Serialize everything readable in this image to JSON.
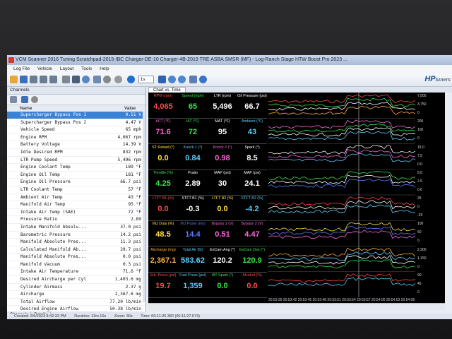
{
  "window": {
    "title": "VCM Scanner 2016 Tuning Scratchpad-2015-IBC Charger-DE-10 Charger-4B-2019 TRE ASBA SMSR (MF) - Log-Ranch Stage HTW Boost Pro 2023 ..."
  },
  "menu": [
    "Log File",
    "Vehicle",
    "Layout",
    "Tools",
    "Help"
  ],
  "toolbar": {
    "zoom_value": "1s"
  },
  "brand": {
    "logo": "HP",
    "logo_suffix": "tuners"
  },
  "channels": {
    "title": "Channels",
    "col_name": "Name",
    "col_value": "Value",
    "rows": [
      {
        "name": "Supercharger Bypass Pos 1",
        "value": "0.51 V",
        "selected": true
      },
      {
        "name": "Supercharger Bypass Pos 2",
        "value": "4.47 V"
      },
      {
        "name": "Vehicle Speed",
        "value": "65 mph"
      },
      {
        "name": "Engine RPM",
        "value": "4,067 rpm"
      },
      {
        "name": "Battery Voltage",
        "value": "14.39 V"
      },
      {
        "name": "Idle Desired RPM",
        "value": "832 rpm"
      },
      {
        "name": "LTR Pump Speed",
        "value": "5,496 rpm"
      },
      {
        "name": "Engine Coolant Temp",
        "value": "189 °F"
      },
      {
        "name": "Engine Oil Temp",
        "value": "181 °F"
      },
      {
        "name": "Engine Oil Pressure",
        "value": "66.7 psi"
      },
      {
        "name": "LTR Coolant Temp",
        "value": "57 °F"
      },
      {
        "name": "Ambient Air Temp",
        "value": "43 °F"
      },
      {
        "name": "Manifold Air Temp",
        "value": "95 °F"
      },
      {
        "name": "Intake Air Temp (SAE)",
        "value": "72 °F"
      },
      {
        "name": "Pressure Ratio",
        "value": "2.89"
      },
      {
        "name": "Intake Manifold Absolu...",
        "value": "37.0 psi"
      },
      {
        "name": "Barometric Pressure",
        "value": "14.2 psi"
      },
      {
        "name": "Manifold Absolute Pres...",
        "value": "11.3 psi"
      },
      {
        "name": "Calculated Manifold Ab...",
        "value": "29.7 psi"
      },
      {
        "name": "Manifold Absolute Pres...",
        "value": "0.0 psi"
      },
      {
        "name": "Manifold Vacuum",
        "value": "0.3 psi"
      },
      {
        "name": "Intake Air Temperature",
        "value": "71.6 °F"
      },
      {
        "name": "Desired Aircharge per Cyl",
        "value": "1,403.6 mg"
      },
      {
        "name": "Cylinder Airmass",
        "value": "2.37 g"
      },
      {
        "name": "Aircharge",
        "value": "2,367.6 mg"
      },
      {
        "name": "Total Airflow",
        "value": "77.20 lb/min"
      },
      {
        "name": "Desired Engine Airflow",
        "value": "50.38 lb/min"
      }
    ],
    "tabs": [
      "Channels",
      "Details"
    ]
  },
  "chart_tab": "Chart vs. Time",
  "gauge_rows": [
    [
      {
        "label": "RPM (rpm)",
        "value": "4,065",
        "color": "#ff4a4a"
      },
      {
        "label": "Speed (mph)",
        "value": "65",
        "color": "#39e64b"
      },
      {
        "label": "LTR (rpm)",
        "value": "5,496",
        "color": "#ffffff"
      },
      {
        "label": "Oil Pressure (psi)",
        "value": "66.7",
        "color": "#ffffff"
      }
    ],
    [
      {
        "label": "ACT (°F)",
        "value": "71.6",
        "color": "#ff66d9"
      },
      {
        "label": "IAT (°F)",
        "value": "72",
        "color": "#39e64b"
      },
      {
        "label": "MAT (°F)",
        "value": "95",
        "color": "#ffffff"
      },
      {
        "label": "Ambient (°F)",
        "value": "43",
        "color": "#5ad0ff"
      }
    ],
    [
      {
        "label": "ST Retard (°)",
        "value": "0.0",
        "color": "#ffe23a"
      },
      {
        "label": "Knock 1 (°)",
        "value": "0.84",
        "color": "#5ad0ff"
      },
      {
        "label": "Knock 2 (°)",
        "value": "0.98",
        "color": "#ff66d9"
      },
      {
        "label": "Spark (°)",
        "value": "8.5",
        "color": "#ffffff"
      }
    ],
    [
      {
        "label": "Throttle (%)",
        "value": "4.25",
        "color": "#39e64b"
      },
      {
        "label": "Pratio",
        "value": "2.89",
        "color": "#ffffff"
      },
      {
        "label": "MAP (psi)",
        "value": "30",
        "color": "#ffffff"
      },
      {
        "label": "MAP (psi)",
        "value": "24.1",
        "color": "#ffffff"
      }
    ],
    [
      {
        "label": "LTFT B1 (%)",
        "value": "0.0",
        "color": "#ff4a4a"
      },
      {
        "label": "STFT B1 (%)",
        "value": "-0.3",
        "color": "#ffffff"
      },
      {
        "label": "LTFT B2 (%)",
        "value": "0.0",
        "color": "#ffe23a"
      },
      {
        "label": "STFT B2 (%)",
        "value": "-4.2",
        "color": "#5ad0ff"
      }
    ],
    [
      {
        "label": "INJ Duty (%)",
        "value": "48.5",
        "color": "#ffe23a"
      },
      {
        "label": "INJ Pulse (ms)",
        "value": "14.4",
        "color": "#5a7dff"
      },
      {
        "label": "Bypass 1 (V)",
        "value": "0.51",
        "color": "#ff66d9"
      },
      {
        "label": "Bypass 2 (V)",
        "value": "4.47",
        "color": "#ff66d9"
      }
    ],
    [
      {
        "label": "Aircharge (mg)",
        "value": "2,367.1",
        "color": "#ffb23a"
      },
      {
        "label": "Total Air (lb)",
        "value": "583.62",
        "color": "#5ad0ff"
      },
      {
        "label": "ExCam Ang (°)",
        "value": "120.2",
        "color": "#ffffff"
      },
      {
        "label": "ExCam Des (°)",
        "value": "120.9",
        "color": "#39e64b"
      }
    ],
    [
      {
        "label": "Eth. Press (psi)",
        "value": "19.7",
        "color": "#ff4a4a"
      },
      {
        "label": "Fuel Press (psi)",
        "value": "1,359",
        "color": "#5ad0ff"
      },
      {
        "label": "IAT Spark (°)",
        "value": "0.0",
        "color": "#39e64b"
      },
      {
        "label": "Alcohol (%)",
        "value": "0.0",
        "color": "#ff4a4a"
      }
    ]
  ],
  "right_scales": [
    [
      "7,500",
      "3,750",
      "0"
    ],
    [
      "200",
      "100",
      "0"
    ],
    [
      "15.0",
      "7.5",
      "0.0"
    ],
    [
      "5.0",
      "2.5",
      "0.0"
    ],
    [
      "25",
      "0",
      "-25"
    ],
    [
      "100",
      "50",
      "0"
    ],
    [
      "2,300",
      "1,150",
      "0"
    ],
    [
      "90",
      "45",
      "0"
    ]
  ],
  "xaxis": "20:53:39 20:53:42 20:53:45 20:53:48 20:53:51 20:53:54 20:53:57 20:54:00 20:54:03 20:54:06",
  "status": {
    "created": "Created: 2/6/2023 8:42:33 PM",
    "duration": "Duration: 13m 16s",
    "zoom": "Zoom: 30s",
    "time": "Time: 00:11:26.382 (00:11:27.674)"
  }
}
